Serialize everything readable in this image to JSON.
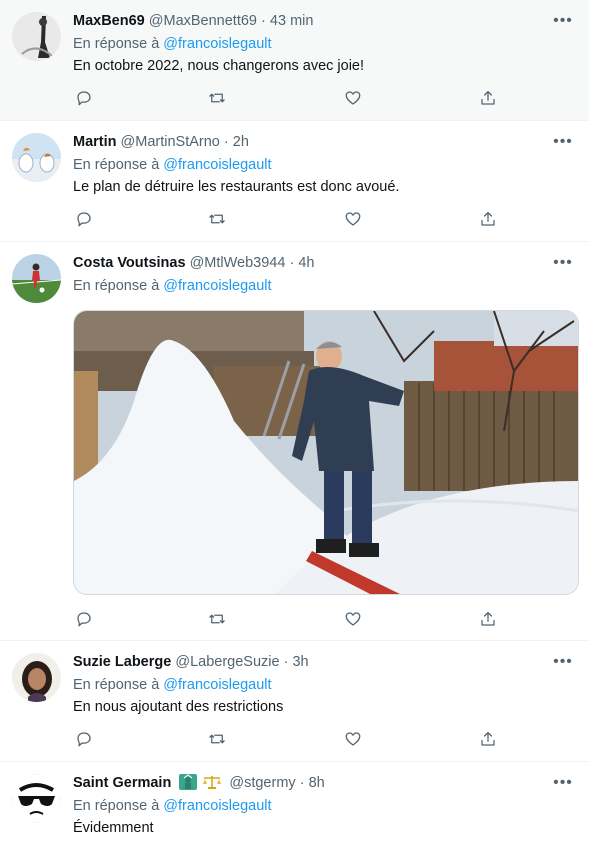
{
  "reply_prefix": "En réponse à",
  "more_label": "•••",
  "dot": "·",
  "colors": {
    "accent": "#1d9bf0",
    "secondary": "#536471",
    "text": "#0f1419",
    "highlight_bg": "#f7f9f9"
  },
  "action_icons": [
    "reply-icon",
    "retweet-icon",
    "like-icon",
    "share-icon"
  ],
  "tweets": [
    {
      "name": "MaxBen69",
      "handle": "@MaxBennett69",
      "time": "43 min",
      "mention": "@francoislegault",
      "text": "En octobre 2022, nous changerons avec joie!"
    },
    {
      "name": "Martin",
      "handle": "@MartinStArno",
      "time": "2h",
      "mention": "@francoislegault",
      "text": "Le plan de détruire les restaurants est donc avoué."
    },
    {
      "name": "Costa Voutsinas",
      "handle": "@MtlWeb3944",
      "time": "4h",
      "mention": "@francoislegault",
      "text": ""
    },
    {
      "name": "Suzie Laberge",
      "handle": "@LabergeSuzie",
      "time": "3h",
      "mention": "@francoislegault",
      "text": "En nous ajoutant des restrictions"
    },
    {
      "name": "Saint Germain",
      "handle": "@stgermy",
      "time": "8h",
      "mention": "@francoislegault",
      "text": "Évidemment",
      "badges": [
        "statue-of-liberty-emoji",
        "balance-scale-emoji"
      ]
    }
  ]
}
